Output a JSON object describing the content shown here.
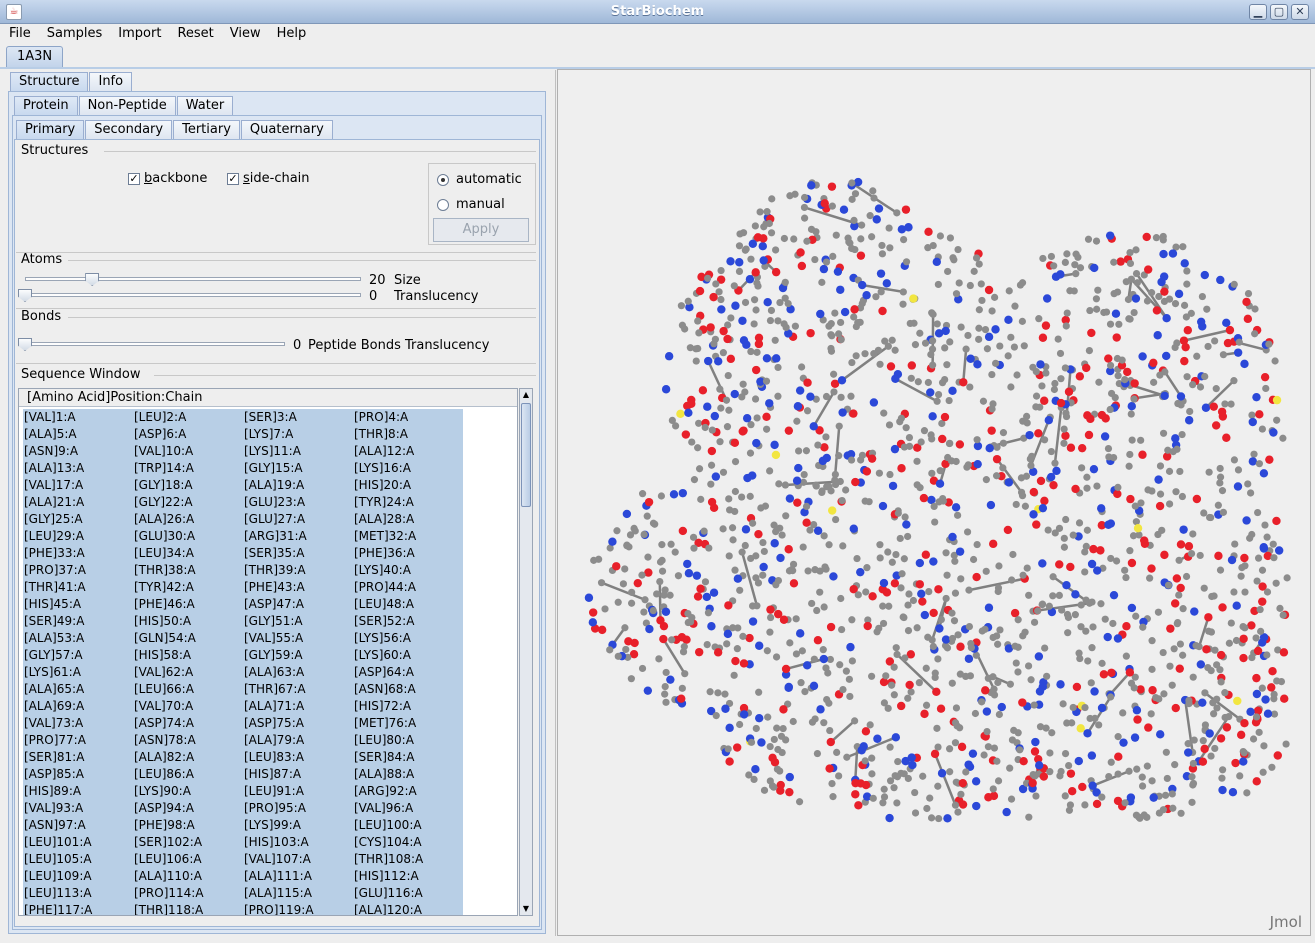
{
  "window": {
    "title": "StarBiochem"
  },
  "menu": [
    "File",
    "Samples",
    "Import",
    "Reset",
    "View",
    "Help"
  ],
  "document_tab": "1A3N",
  "tabs_level1": [
    "Structure",
    "Info"
  ],
  "tabs_level2": [
    "Protein",
    "Non-Peptide",
    "Water"
  ],
  "tabs_level3": [
    "Primary",
    "Secondary",
    "Tertiary",
    "Quaternary"
  ],
  "structures": {
    "label": "Structures",
    "backbone": {
      "pre": "",
      "mnemonic": "b",
      "rest": "ackbone",
      "checked": true
    },
    "side_chain": {
      "pre": "",
      "mnemonic": "s",
      "rest": "ide-chain",
      "checked": true
    },
    "automatic": "automatic",
    "manual": "manual",
    "selected": "automatic",
    "apply": "Apply"
  },
  "atoms": {
    "label": "Atoms",
    "size_value": "20",
    "size_label": "Size",
    "size_level": 0.2,
    "translucency_value": "0",
    "translucency_label": "Translucency",
    "translucency_level": 0
  },
  "bonds": {
    "label": "Bonds",
    "value": "0",
    "label_text": "Peptide Bonds Translucency",
    "level": 0
  },
  "sequence": {
    "label": "Sequence Window",
    "header": "[Amino Acid]Position:Chain",
    "rows": [
      [
        "[VAL]1:A",
        "[LEU]2:A",
        "[SER]3:A",
        "[PRO]4:A"
      ],
      [
        "[ALA]5:A",
        "[ASP]6:A",
        "[LYS]7:A",
        "[THR]8:A"
      ],
      [
        "[ASN]9:A",
        "[VAL]10:A",
        "[LYS]11:A",
        "[ALA]12:A"
      ],
      [
        "[ALA]13:A",
        "[TRP]14:A",
        "[GLY]15:A",
        "[LYS]16:A"
      ],
      [
        "[VAL]17:A",
        "[GLY]18:A",
        "[ALA]19:A",
        "[HIS]20:A"
      ],
      [
        "[ALA]21:A",
        "[GLY]22:A",
        "[GLU]23:A",
        "[TYR]24:A"
      ],
      [
        "[GLY]25:A",
        "[ALA]26:A",
        "[GLU]27:A",
        "[ALA]28:A"
      ],
      [
        "[LEU]29:A",
        "[GLU]30:A",
        "[ARG]31:A",
        "[MET]32:A"
      ],
      [
        "[PHE]33:A",
        "[LEU]34:A",
        "[SER]35:A",
        "[PHE]36:A"
      ],
      [
        "[PRO]37:A",
        "[THR]38:A",
        "[THR]39:A",
        "[LYS]40:A"
      ],
      [
        "[THR]41:A",
        "[TYR]42:A",
        "[PHE]43:A",
        "[PRO]44:A"
      ],
      [
        "[HIS]45:A",
        "[PHE]46:A",
        "[ASP]47:A",
        "[LEU]48:A"
      ],
      [
        "[SER]49:A",
        "[HIS]50:A",
        "[GLY]51:A",
        "[SER]52:A"
      ],
      [
        "[ALA]53:A",
        "[GLN]54:A",
        "[VAL]55:A",
        "[LYS]56:A"
      ],
      [
        "[GLY]57:A",
        "[HIS]58:A",
        "[GLY]59:A",
        "[LYS]60:A"
      ],
      [
        "[LYS]61:A",
        "[VAL]62:A",
        "[ALA]63:A",
        "[ASP]64:A"
      ],
      [
        "[ALA]65:A",
        "[LEU]66:A",
        "[THR]67:A",
        "[ASN]68:A"
      ],
      [
        "[ALA]69:A",
        "[VAL]70:A",
        "[ALA]71:A",
        "[HIS]72:A"
      ],
      [
        "[VAL]73:A",
        "[ASP]74:A",
        "[ASP]75:A",
        "[MET]76:A"
      ],
      [
        "[PRO]77:A",
        "[ASN]78:A",
        "[ALA]79:A",
        "[LEU]80:A"
      ],
      [
        "[SER]81:A",
        "[ALA]82:A",
        "[LEU]83:A",
        "[SER]84:A"
      ],
      [
        "[ASP]85:A",
        "[LEU]86:A",
        "[HIS]87:A",
        "[ALA]88:A"
      ],
      [
        "[HIS]89:A",
        "[LYS]90:A",
        "[LEU]91:A",
        "[ARG]92:A"
      ],
      [
        "[VAL]93:A",
        "[ASP]94:A",
        "[PRO]95:A",
        "[VAL]96:A"
      ],
      [
        "[ASN]97:A",
        "[PHE]98:A",
        "[LYS]99:A",
        "[LEU]100:A"
      ],
      [
        "[LEU]101:A",
        "[SER]102:A",
        "[HIS]103:A",
        "[CYS]104:A"
      ],
      [
        "[LEU]105:A",
        "[LEU]106:A",
        "[VAL]107:A",
        "[THR]108:A"
      ],
      [
        "[LEU]109:A",
        "[ALA]110:A",
        "[ALA]111:A",
        "[HIS]112:A"
      ],
      [
        "[LEU]113:A",
        "[PRO]114:A",
        "[ALA]115:A",
        "[GLU]116:A"
      ],
      [
        "[PHE]117:A",
        "[THR]118:A",
        "[PRO]119:A",
        "[ALA]120:A"
      ]
    ]
  },
  "viewer": {
    "watermark": "Jmol",
    "atom_colors": {
      "carbon": "#8c8c8c",
      "oxygen": "#e8202a",
      "nitrogen": "#2b48d8",
      "sulfur": "#f2e640"
    }
  }
}
